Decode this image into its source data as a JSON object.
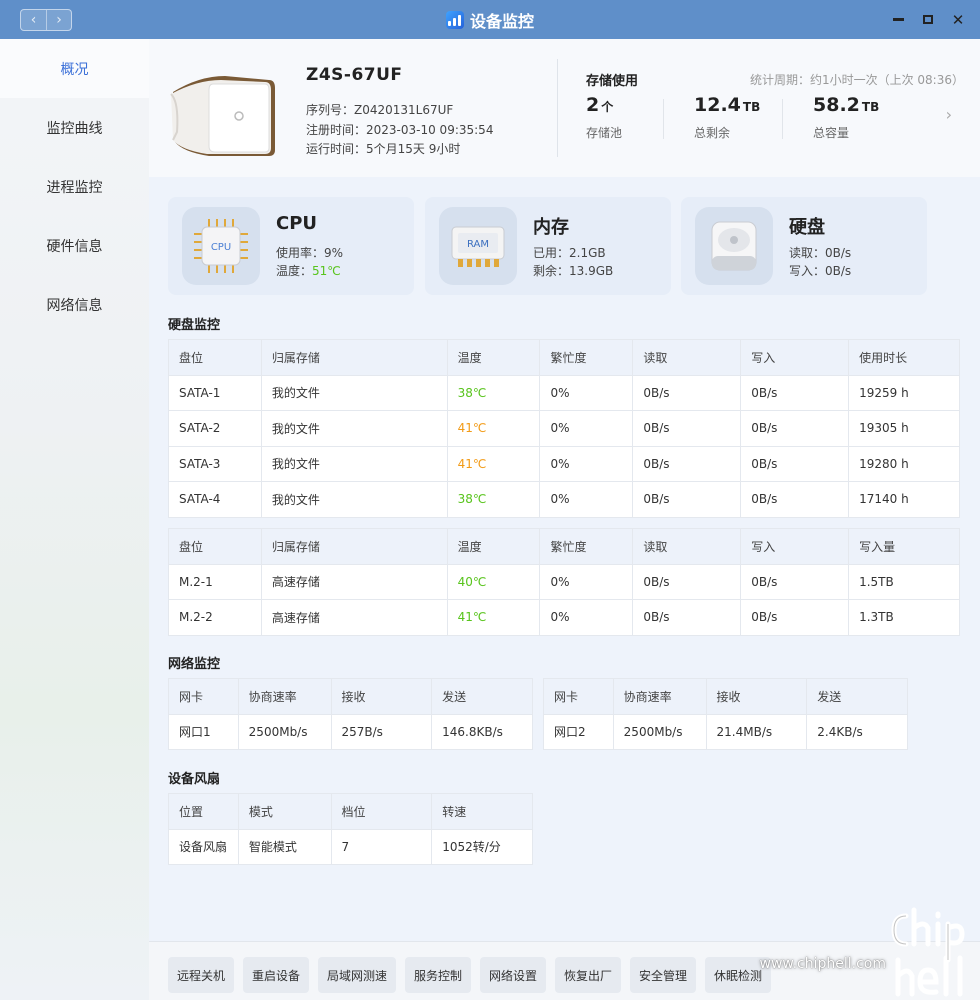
{
  "window": {
    "title": "设备监控",
    "back": "‹",
    "forward": "›"
  },
  "sidebar": {
    "items": [
      {
        "label": "概况",
        "active": true
      },
      {
        "label": "监控曲线"
      },
      {
        "label": "进程监控"
      },
      {
        "label": "硬件信息"
      },
      {
        "label": "网络信息"
      }
    ]
  },
  "device": {
    "name": "Z4S-67UF",
    "serial": "序列号：Z0420131L67UF",
    "registered": "注册时间：2023-03-10 09:35:54",
    "uptime": "运行时间：5个月15天 9小时"
  },
  "storage": {
    "title": "存储使用",
    "period": "统计周期：约1小时一次（上次 08:36）",
    "pools": {
      "value": "2",
      "unit": "个",
      "label": "存储池"
    },
    "free": {
      "value": "12.4",
      "unit": "TB",
      "label": "总剩余"
    },
    "total": {
      "value": "58.2",
      "unit": "TB",
      "label": "总容量"
    },
    "more": "›"
  },
  "summary": {
    "cpu": {
      "title": "CPU",
      "chip": "CPU",
      "usage_label": "使用率：",
      "usage": "9%",
      "temp_label": "温度：",
      "temp": "51℃"
    },
    "memory": {
      "title": "内存",
      "chip": "RAM",
      "used": "已用：2.1GB",
      "free": "剩余：13.9GB"
    },
    "disk": {
      "title": "硬盘",
      "read": "读取：0B/s",
      "write": "写入：0B/s"
    }
  },
  "disk_monitor": {
    "title": "硬盘监控",
    "sata_headers": [
      "盘位",
      "归属存储",
      "温度",
      "繁忙度",
      "读取",
      "写入",
      "使用时长"
    ],
    "sata_rows": [
      [
        "SATA-1",
        "我的文件",
        "38℃",
        "0%",
        "0B/s",
        "0B/s",
        "19259 h"
      ],
      [
        "SATA-2",
        "我的文件",
        "41℃",
        "0%",
        "0B/s",
        "0B/s",
        "19305 h"
      ],
      [
        "SATA-3",
        "我的文件",
        "41℃",
        "0%",
        "0B/s",
        "0B/s",
        "19280 h"
      ],
      [
        "SATA-4",
        "我的文件",
        "38℃",
        "0%",
        "0B/s",
        "0B/s",
        "17140 h"
      ]
    ],
    "m2_headers": [
      "盘位",
      "归属存储",
      "温度",
      "繁忙度",
      "读取",
      "写入",
      "写入量"
    ],
    "m2_rows": [
      [
        "M.2-1",
        "高速存储",
        "40℃",
        "0%",
        "0B/s",
        "0B/s",
        "1.5TB"
      ],
      [
        "M.2-2",
        "高速存储",
        "41℃",
        "0%",
        "0B/s",
        "0B/s",
        "1.3TB"
      ]
    ]
  },
  "network": {
    "title": "网络监控",
    "headers": [
      "网卡",
      "协商速率",
      "接收",
      "发送"
    ],
    "port1": [
      "网口1",
      "2500Mb/s",
      "257B/s",
      "146.8KB/s"
    ],
    "port2": [
      "网口2",
      "2500Mb/s",
      "21.4MB/s",
      "2.4KB/s"
    ]
  },
  "fan": {
    "title": "设备风扇",
    "headers": [
      "位置",
      "模式",
      "档位",
      "转速"
    ],
    "row": [
      "设备风扇",
      "智能模式",
      "7",
      "1052转/分"
    ]
  },
  "actions": [
    "远程关机",
    "重启设备",
    "局域网测速",
    "服务控制",
    "网络设置",
    "恢复出厂",
    "安全管理",
    "休眠检测"
  ],
  "watermark": "www.chiphell.com",
  "colors": {
    "accent": "#3a6fd8",
    "temp_normal": "#58c41c",
    "temp_warm": "#f29b17",
    "titlebar": "#5f8fc9"
  }
}
